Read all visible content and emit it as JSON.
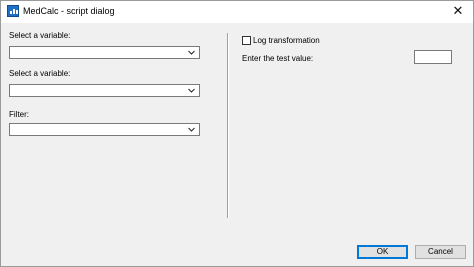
{
  "window": {
    "title": "MedCalc - script dialog",
    "app_icon": "medcalc-app-icon",
    "close_glyph": "✕"
  },
  "left_panel": {
    "variable1": {
      "label": "Select a variable:",
      "value": ""
    },
    "variable2": {
      "label": "Select a variable:",
      "value": ""
    },
    "filter": {
      "label": "Filter:",
      "value": ""
    }
  },
  "right_panel": {
    "log_transformation": {
      "label": "Log transformation",
      "checked": false
    },
    "test_value": {
      "label": "Enter the test value:",
      "value": ""
    }
  },
  "buttons": {
    "ok": "OK",
    "cancel": "Cancel"
  }
}
